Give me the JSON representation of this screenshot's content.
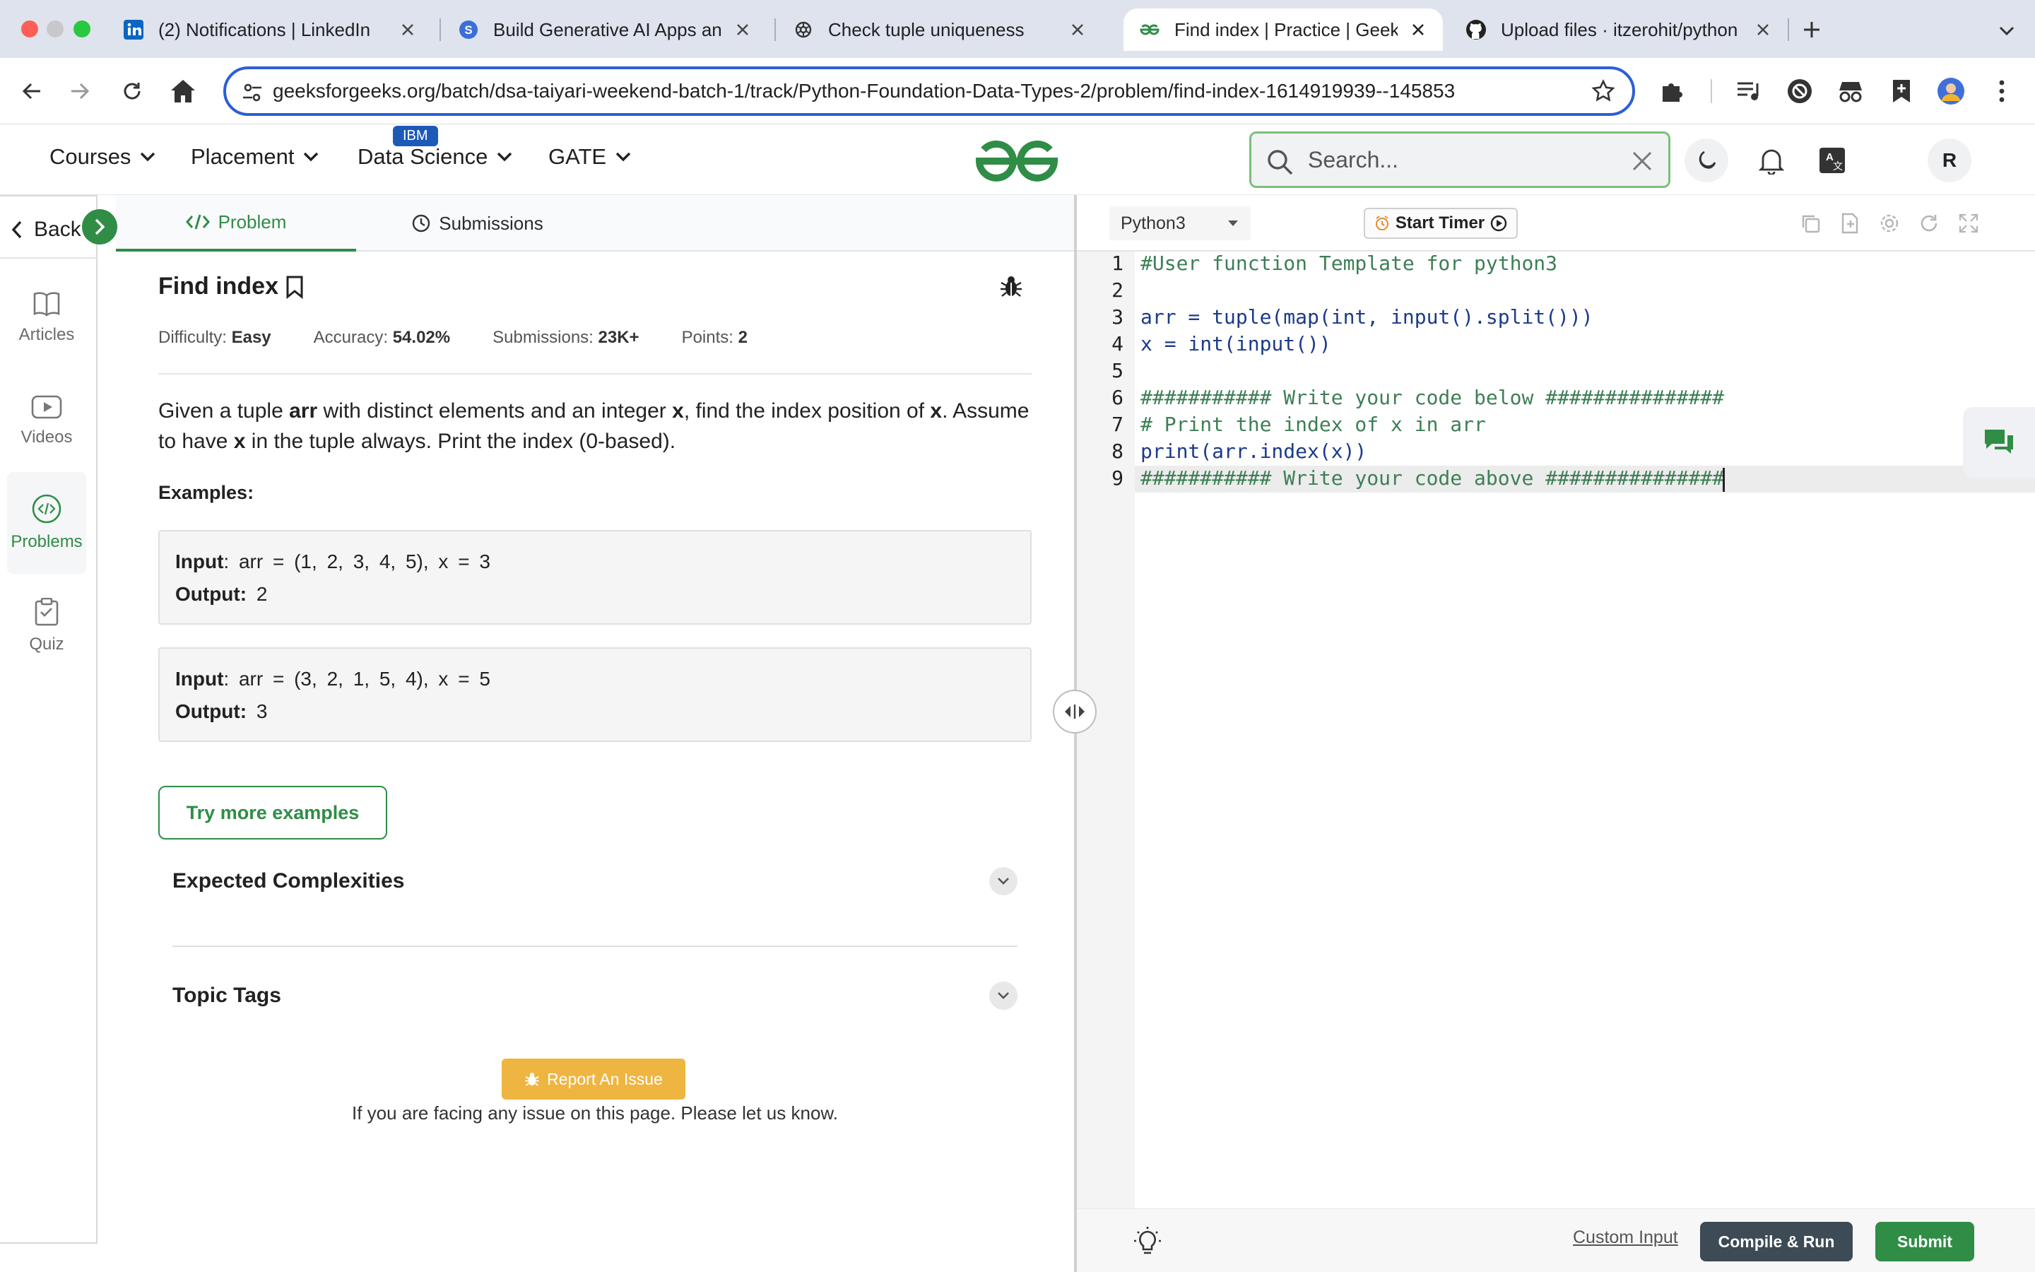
{
  "browser": {
    "tabs": [
      {
        "title": "(2) Notifications | LinkedIn",
        "icon": "linkedin-icon"
      },
      {
        "title": "Build Generative AI Apps and",
        "icon": "app-icon"
      },
      {
        "title": "Check tuple uniqueness",
        "icon": "openai-icon"
      },
      {
        "title": "Find index | Practice | GeeksforGeeks",
        "icon": "gfg-icon"
      },
      {
        "title": "Upload files · itzerohit/python",
        "icon": "github-icon"
      }
    ],
    "url": "geeksforgeeks.org/batch/dsa-taiyari-weekend-batch-1/track/Python-Foundation-Data-Types-2/problem/find-index-1614919939--145853",
    "profile_initial": "R"
  },
  "header": {
    "menus": [
      "Courses",
      "Placement",
      "Data Science",
      "GATE"
    ],
    "ibm_badge": "IBM",
    "search_placeholder": "Search...",
    "avatar_initial": "R"
  },
  "rail": {
    "back_label": "Back",
    "items": [
      {
        "label": "Articles",
        "icon": "book-icon"
      },
      {
        "label": "Videos",
        "icon": "video-icon"
      },
      {
        "label": "Problems",
        "icon": "code-icon"
      },
      {
        "label": "Quiz",
        "icon": "clipboard-icon"
      }
    ]
  },
  "problem": {
    "tabs": [
      "Problem",
      "Submissions"
    ],
    "title": "Find index",
    "meta": {
      "difficulty_label": "Difficulty:",
      "difficulty": "Easy",
      "accuracy_label": "Accuracy:",
      "accuracy": "54.02%",
      "submissions_label": "Submissions:",
      "submissions": "23K+",
      "points_label": "Points:",
      "points": "2"
    },
    "description": {
      "p1": "Given a tuple ",
      "b1": "arr",
      "p2": " with distinct elements and an integer ",
      "b2": "x",
      "p3": ", find the index position of ",
      "b3": "x",
      "p4": ". Assume to have ",
      "b4": "x",
      "p5": " in the tuple always. Print the index (0-based)."
    },
    "examples_heading": "Examples:",
    "examples": [
      {
        "input_label": "Input",
        "input": ":  arr = (1, 2, 3, 4, 5), x = 3",
        "output_label": "Output:",
        "output": " 2"
      },
      {
        "input_label": "Input",
        "input": ":  arr = (3, 2, 1, 5, 4), x = 5",
        "output_label": "Output:",
        "output": " 3"
      }
    ],
    "try_more": "Try more examples",
    "accordions": [
      "Expected Complexities",
      "Topic Tags"
    ],
    "report_button": "Report An Issue",
    "report_note": "If you are facing any issue on this page. Please let us know."
  },
  "editor": {
    "language": "Python3",
    "timer_label": "Start Timer",
    "line_numbers": [
      "1",
      "2",
      "3",
      "4",
      "5",
      "6",
      "7",
      "8",
      "9"
    ],
    "code": [
      "#User function Template for python3",
      "",
      "arr = tuple(map(int, input().split()))",
      "x = int(input())",
      "",
      "########### Write your code below ###############",
      "# Print the index of x in arr",
      "print(arr.index(x))",
      "########### Write your code above ###############"
    ],
    "custom_input": "Custom Input",
    "compile_run": "Compile & Run",
    "submit": "Submit"
  },
  "colors": {
    "gfg_green": "#2f8d46",
    "report_yellow": "#efb541",
    "compile_dark": "#3c4b55"
  }
}
